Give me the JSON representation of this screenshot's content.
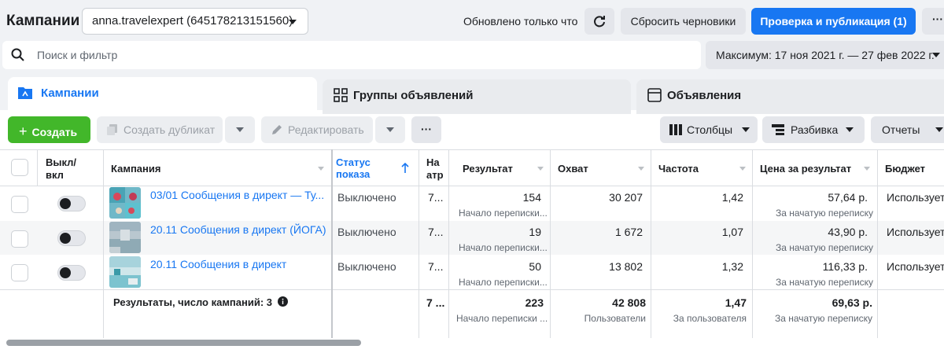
{
  "header": {
    "title": "Кампании",
    "account": "anna.travelexpert (645178213151560)",
    "updated": "Обновлено только что",
    "reset_label": "Сбросить черновики",
    "publish_label": "Проверка и публикация (1)",
    "more_label": "···"
  },
  "search": {
    "placeholder": "Поиск и фильтр"
  },
  "date_range": "Максимум: 17 ноя 2021 г. — 27 фев 2022 г.",
  "tabs": [
    {
      "label": "Кампании"
    },
    {
      "label": "Группы объявлений"
    },
    {
      "label": "Объявления"
    }
  ],
  "toolbar": {
    "create": "Создать",
    "duplicate": "Создать дубликат",
    "edit": "Редактировать",
    "more": "···",
    "columns": "Столбцы",
    "breakdown": "Разбивка",
    "reports": "Отчеты"
  },
  "columns": {
    "toggle": "Выкл/\nвкл",
    "toggle_1": "Выкл/",
    "toggle_2": "вкл",
    "campaign": "Кампания",
    "status_1": "Статус",
    "status_2": "показа",
    "attr_1": "На",
    "attr_2": "атр",
    "result": "Результат",
    "reach": "Охват",
    "frequency": "Частота",
    "cost": "Цена за результат",
    "budget": "Бюджет"
  },
  "rows": [
    {
      "name": "03/01 Сообщения в директ — Ту...",
      "status": "Выключено",
      "attr": "7...",
      "result": "154",
      "result_sub": "Начало переписки...",
      "reach": "30 207",
      "freq": "1,42",
      "cost": "57,64 р.",
      "cost_sub": "За начатую переписку",
      "budget": "Использует"
    },
    {
      "name": "20.11 Сообщения в директ (ЙОГА)",
      "status": "Выключено",
      "attr": "7...",
      "result": "19",
      "result_sub": "Начало переписки...",
      "reach": "1 672",
      "freq": "1,07",
      "cost": "43,90 р.",
      "cost_sub": "За начатую переписку",
      "budget": "Использует"
    },
    {
      "name": "20.11 Сообщения в директ",
      "status": "Выключено",
      "attr": "7...",
      "result": "50",
      "result_sub": "Начало переписки...",
      "reach": "13 802",
      "freq": "1,32",
      "cost": "116,33 р.",
      "cost_sub": "За начатую переписку",
      "budget": "Использует"
    }
  ],
  "totals": {
    "label": "Результаты, число кампаний: 3",
    "attr": "7 ...",
    "result": "223",
    "result_sub": "Начало переписки ...",
    "reach": "42 808",
    "reach_sub": "Пользователи",
    "freq": "1,47",
    "freq_sub": "За пользователя",
    "cost": "69,63 р.",
    "cost_sub": "За начатую переписку"
  },
  "colors": {
    "accent": "#1877f2",
    "create": "#42b72a"
  }
}
